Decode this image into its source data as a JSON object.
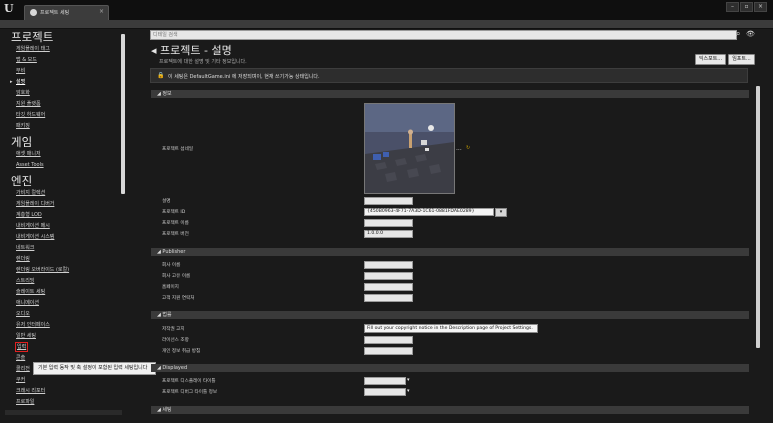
{
  "window": {
    "tab_label": "프로젝트 세팅",
    "tab_close": "×",
    "minimize": "–",
    "maximize": "▫",
    "close": "×"
  },
  "sidebar": {
    "sections": [
      {
        "title": "프로젝트",
        "items": [
          "게임플레이 태그",
          "맵 & 모드",
          "무비",
          "설명",
          "암호화",
          "지원 플랫폼",
          "타깃 하드웨어",
          "패키징"
        ],
        "active_index": 3
      },
      {
        "title": "게임",
        "items": [
          "애셋 매니저",
          "Asset Tools"
        ]
      },
      {
        "title": "엔진",
        "items": [
          "가비지 컬렉션",
          "게임플레이 디버거",
          "계층형 LOD",
          "내비게이션 메시",
          "내비게이션 시스템",
          "네트워크",
          "렌더링",
          "렌더링 오버라이드 (로컬)",
          "스트리밍",
          "슬레이트 세팅",
          "애니메이션",
          "오디오",
          "유저 인터페이스",
          "일반 세팅",
          "입력",
          "콘솔",
          "콜리전",
          "쿠커",
          "크래시 리포터",
          "프로파일"
        ]
      }
    ],
    "arrow_glyph": "▸",
    "tooltip": "기본 입력 동작 및 축 설정이 포함된 입력 세팅입니다"
  },
  "main": {
    "search_placeholder": "디테일 검색",
    "search_icon": "⌕",
    "eye_icon": "👁",
    "title": "◂ 프로젝트 - 설명",
    "subtitle": "프로젝트에 대한 설명 및 기타 정보입니다.",
    "export_label": "익스포트...",
    "import_label": "임포트...",
    "notice_icon": "🔒",
    "notice": "이 세팅은 DefaultGame.ini 에 저장되며이, 현재 쓰기가능 상태입니다.",
    "sections": {
      "about": "◢ 정보",
      "publisher": "◢ Publisher",
      "legal": "◢ 법률",
      "displayed": "◢ Displayed",
      "settings": "◢ 세팅"
    },
    "about": {
      "thumbnail_label": "프로젝트 섬네일",
      "thumbnail_more": "...",
      "thumbnail_reset": "↻",
      "description_label": "설명",
      "project_id_label": "프로젝트 ID",
      "project_id_value": "{450B0963-4F71-7A3D-1C61-0881FDAE0289}",
      "combo_arrow": "▾",
      "project_name_label": "프로젝트 이름",
      "project_version_label": "프로젝트 버전",
      "project_version_value": "1.0.0.0"
    },
    "publisher": {
      "company_label": "회사 이름",
      "company_id_label": "회사 고유 이름",
      "homepage_label": "홈페이지",
      "support_label": "고객 지원 연락처"
    },
    "legal": {
      "copyright_label": "저작권 고지",
      "copyright_value": "Fill out your copyright notice in the Description page of Project Settings.",
      "license_label": "라이선스 조항",
      "privacy_label": "개인 정보 취급 방침"
    },
    "displayed": {
      "display_title_label": "프로젝트 디스플레이 타이틀",
      "debug_title_label": "프로젝트 디버그 타이틀 정보",
      "arrow": "▾"
    }
  },
  "colors": {
    "accent_red": "#e02020",
    "reset_yellow": "#c8a000"
  }
}
